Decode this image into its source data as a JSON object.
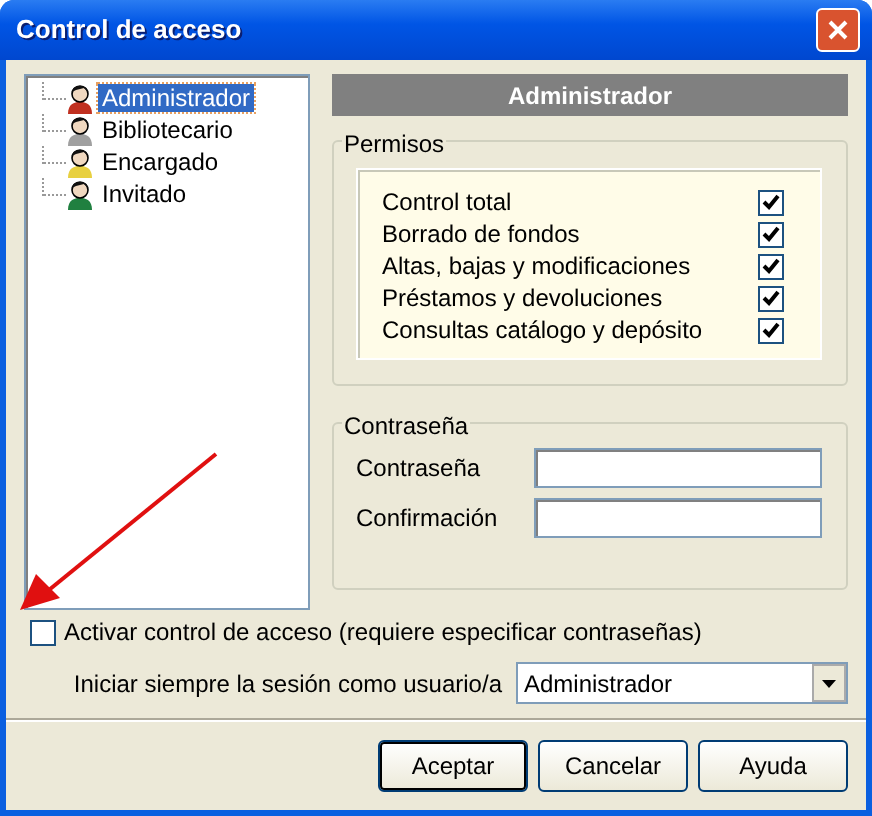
{
  "window": {
    "title": "Control de acceso"
  },
  "users": [
    {
      "label": "Administrador",
      "selected": true,
      "color": "#c03020"
    },
    {
      "label": "Bibliotecario",
      "selected": false,
      "color": "#a0a0a0"
    },
    {
      "label": "Encargado",
      "selected": false,
      "color": "#e8d040"
    },
    {
      "label": "Invitado",
      "selected": false,
      "color": "#208040"
    }
  ],
  "detail_header": "Administrador",
  "permissions": {
    "legend": "Permisos",
    "items": [
      {
        "label": "Control total",
        "checked": true
      },
      {
        "label": "Borrado de fondos",
        "checked": true
      },
      {
        "label": "Altas, bajas y modificaciones",
        "checked": true
      },
      {
        "label": "Préstamos y devoluciones",
        "checked": true
      },
      {
        "label": "Consultas catálogo y depósito",
        "checked": true
      }
    ]
  },
  "password": {
    "legend": "Contraseña",
    "fields": [
      {
        "label": "Contraseña"
      },
      {
        "label": "Confirmación"
      }
    ]
  },
  "enable_access_control": {
    "label": "Activar control de acceso (requiere especificar contraseñas)",
    "checked": false
  },
  "start_as": {
    "label": "Iniciar siempre la sesión como usuario/a",
    "value": "Administrador"
  },
  "buttons": [
    {
      "label": "Aceptar",
      "default": true
    },
    {
      "label": "Cancelar",
      "default": false
    },
    {
      "label": "Ayuda",
      "default": false
    }
  ]
}
